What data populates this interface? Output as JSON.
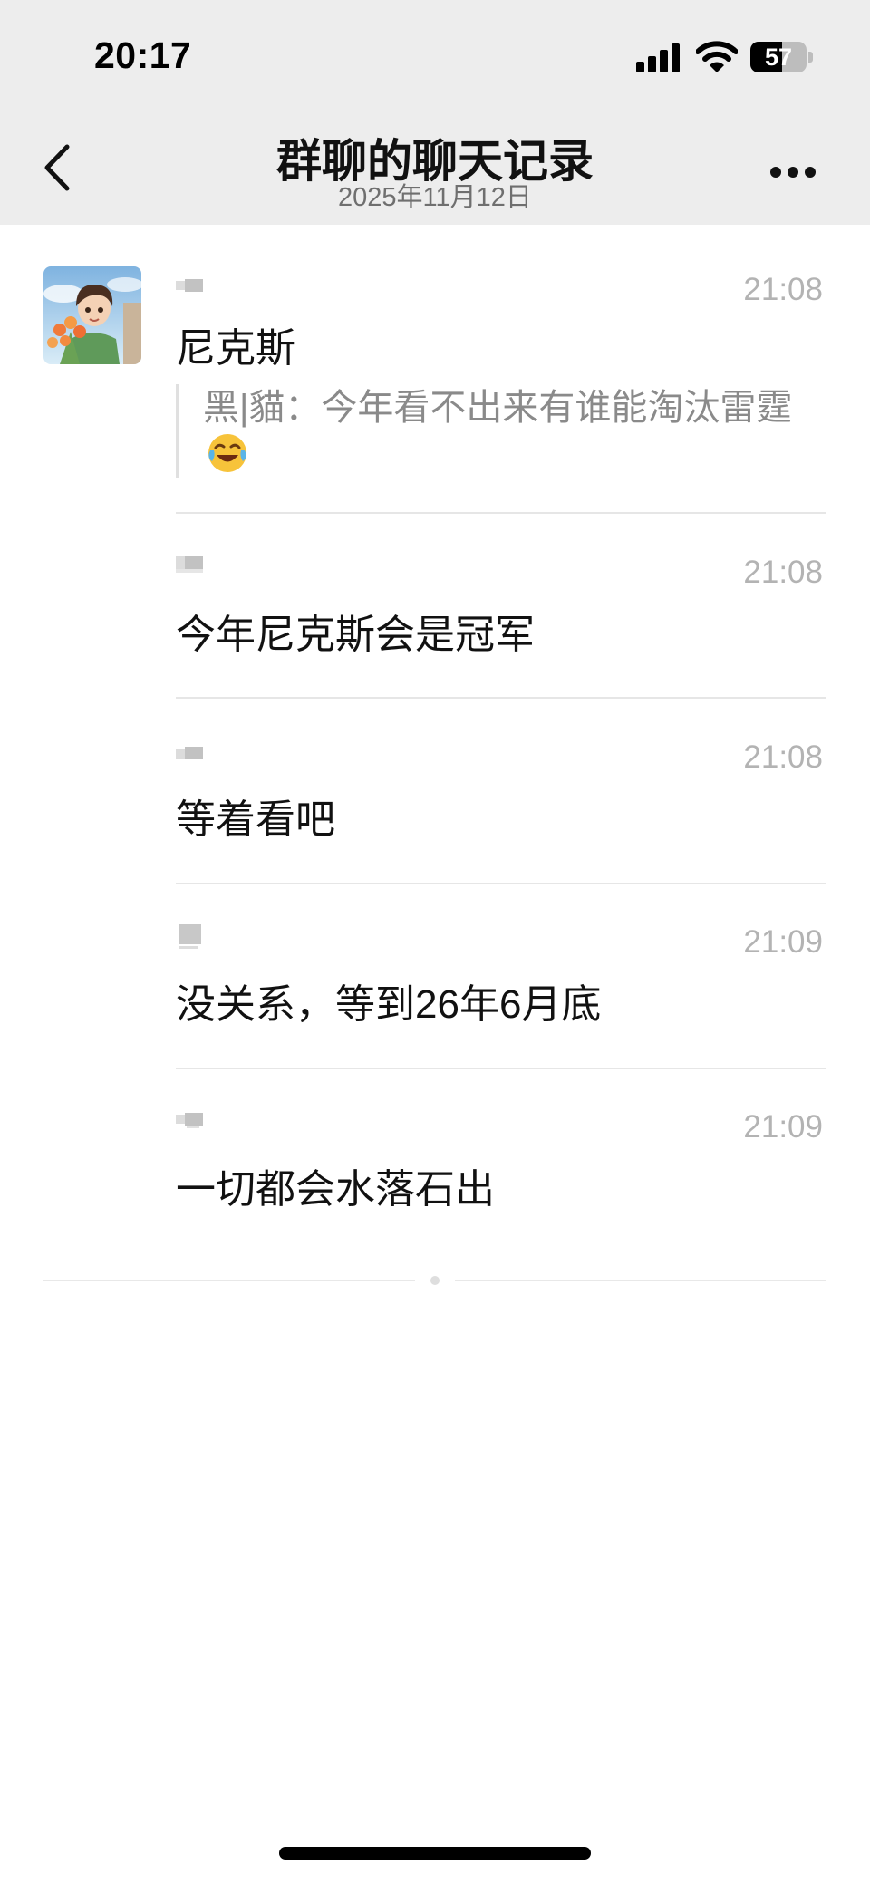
{
  "status_bar": {
    "time": "20:17",
    "battery_level": "57",
    "battery_fraction": 0.57
  },
  "nav": {
    "title": "群聊的聊天记录",
    "subtitle": "2025年11月12日"
  },
  "icons": {
    "back": "chevron-left-icon",
    "more": "more-dots-icon",
    "emoji": "laughing-crying-emoji"
  },
  "messages": [
    {
      "time": "21:08",
      "text": "尼克斯",
      "quote": "黑|貓：今年看不出来有谁能淘汰雷霆"
    },
    {
      "time": "21:08",
      "text": "今年尼克斯会是冠军"
    },
    {
      "time": "21:08",
      "text": "等着看吧"
    },
    {
      "time": "21:09",
      "text": "没关系，等到26年6月底"
    },
    {
      "time": "21:09",
      "text": "一切都会水落石出"
    }
  ],
  "colors": {
    "header_bg": "#ededed",
    "time_text": "#b3b3b3",
    "quote_text": "#8a8a8a"
  }
}
